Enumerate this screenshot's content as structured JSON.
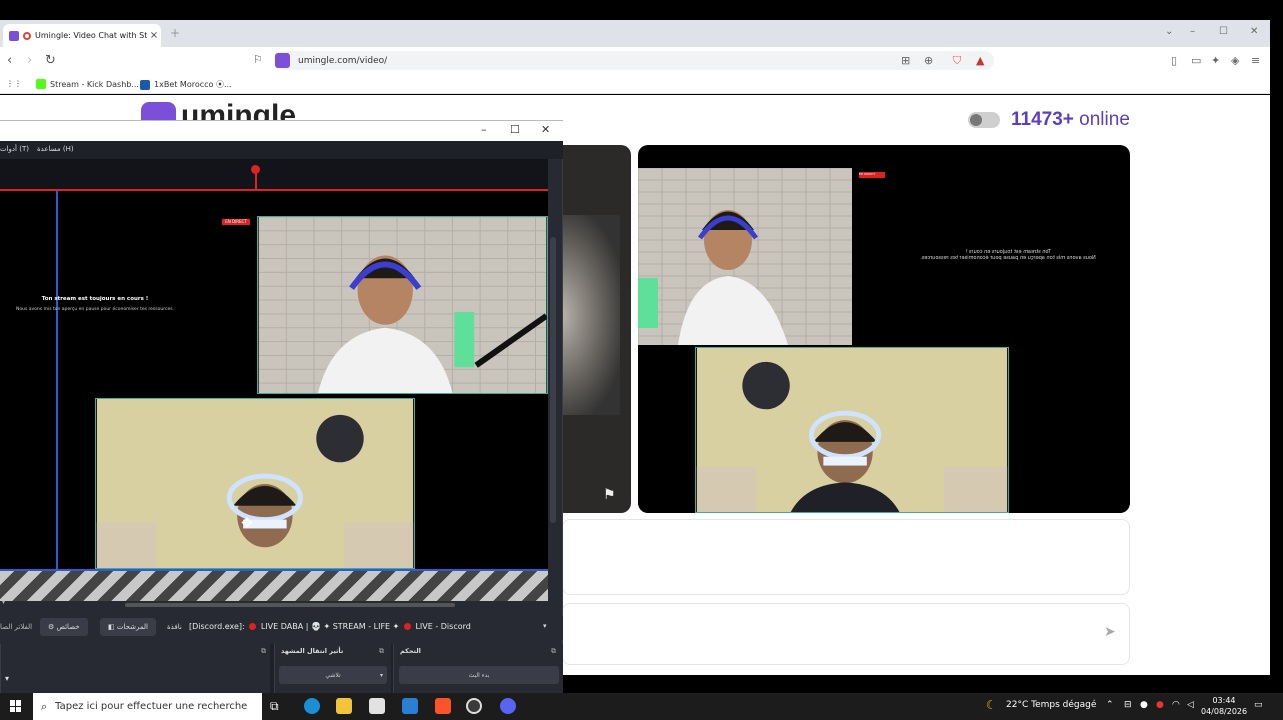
{
  "browser": {
    "tab": {
      "title": "Umingle: Video Chat with Str",
      "close": "×"
    },
    "new_tab": "+",
    "window_controls": [
      "⌄",
      "–",
      "☐",
      "✕"
    ],
    "url": "umingle.com/video/",
    "bookmarks": [
      {
        "label": "Stream - Kick Dashb...",
        "color": "#53fc18"
      },
      {
        "label": "1xBet Morocco ⦿...",
        "color": "#1a5aa8"
      }
    ]
  },
  "page": {
    "brand": "umingle",
    "online_count": "11473+",
    "online_label": "online",
    "video_overlay": {
      "badge": "EN DIRECT",
      "line1": "Ton stream est toujours en cours !",
      "line2": "Nous avons mis ton aperçu en pause pour économiser tes ressources."
    }
  },
  "obs": {
    "window_controls": [
      "–",
      "☐",
      "✕"
    ],
    "menu": [
      "أدوات (T)",
      "مساعدة (H)"
    ],
    "canvas": {
      "badge": "EN DIRECT",
      "line1": "Ton stream est toujours en cours !",
      "line2": "Nous avons mis ton aperçu en pause pour économiser tes ressources."
    },
    "toolbar": {
      "left_label": "الفلاتر الصا",
      "props_button": "خصائص",
      "filters_button": "المرشحات",
      "window_label": "نافذة",
      "source": "[Discord.exe]:",
      "source_rest": "LIVE DABA | 💀 ✦ STREAM - LIFE ✦",
      "source_end": "LIVE - Discord"
    },
    "docks": [
      {
        "title": "تأثير انتقال المشهد",
        "select": "تلاشي"
      },
      {
        "title": "التحكم",
        "select": "بدء البث"
      }
    ]
  },
  "taskbar": {
    "search_placeholder": "Tapez ici pour effectuer une recherche",
    "weather": "22°C  Temps dégagé",
    "time": "03:44",
    "date": "04/08/2026"
  }
}
